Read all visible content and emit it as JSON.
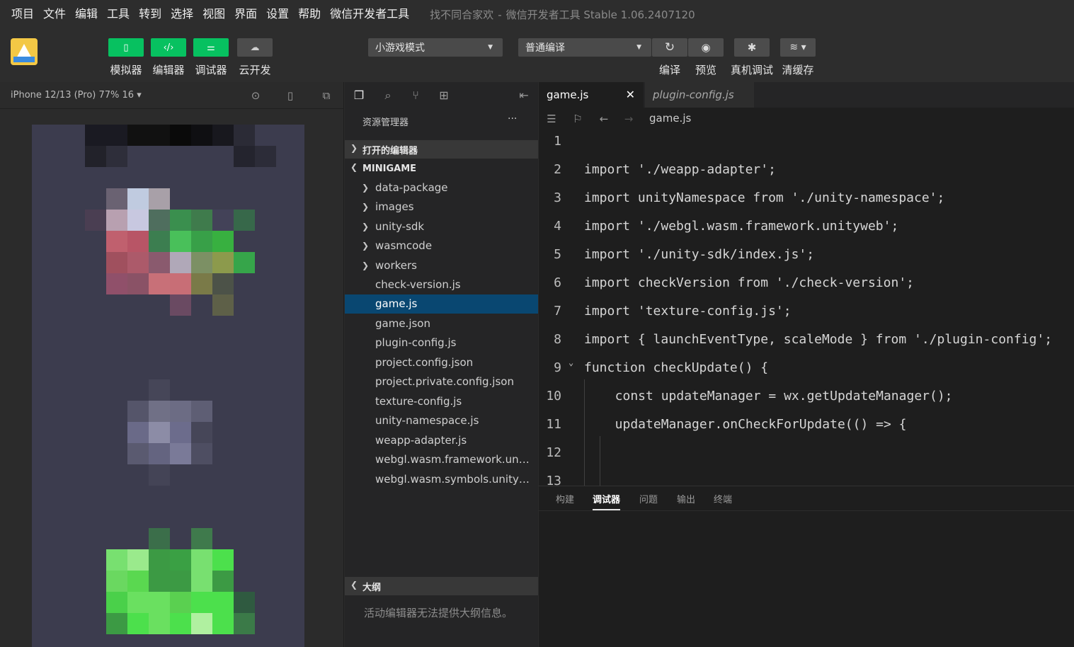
{
  "menubar": {
    "items": [
      "项目",
      "文件",
      "编辑",
      "工具",
      "转到",
      "选择",
      "视图",
      "界面",
      "设置",
      "帮助",
      "微信开发者工具"
    ],
    "project_name": "找不同合家欢",
    "separator": "-",
    "app_title": "微信开发者工具 Stable 1.06.2407120"
  },
  "toolbar": {
    "simulator": "模拟器",
    "editor": "编辑器",
    "debugger": "调试器",
    "cloud": "云开发",
    "mode_select": "小游戏模式",
    "compile_select": "普通编译",
    "compile": "编译",
    "preview": "预览",
    "remote_debug": "真机调试",
    "clear_cache": "清缓存",
    "accent_color": "#07c160"
  },
  "simulator": {
    "device": "iPhone 12/13 (Pro) 77% 16 ▾"
  },
  "explorer": {
    "title": "资源管理器",
    "more": "···",
    "open_editors": "打开的编辑器",
    "project": "MINIGAME",
    "folders": [
      "data-package",
      "images",
      "unity-sdk",
      "wasmcode",
      "workers"
    ],
    "files": [
      "check-version.js",
      "game.js",
      "game.json",
      "plugin-config.js",
      "project.config.json",
      "project.private.config.json",
      "texture-config.js",
      "unity-namespace.js",
      "weapp-adapter.js",
      "webgl.wasm.framework.unityweb",
      "webgl.wasm.symbols.unityweb"
    ],
    "selected_file": "game.js",
    "outline": "大纲",
    "outline_message": "活动编辑器无法提供大纲信息。"
  },
  "editor": {
    "tabs": [
      {
        "label": "game.js",
        "active": true
      },
      {
        "label": "plugin-config.js",
        "active": false
      }
    ],
    "close_glyph": "✕",
    "breadcrumb": "game.js",
    "lines": [
      {
        "n": "1",
        "text": ""
      },
      {
        "n": "2",
        "text": "import './weapp-adapter';"
      },
      {
        "n": "3",
        "text": "import unityNamespace from './unity-namespace';"
      },
      {
        "n": "4",
        "text": "import './webgl.wasm.framework.unityweb';"
      },
      {
        "n": "5",
        "text": "import './unity-sdk/index.js';"
      },
      {
        "n": "6",
        "text": "import checkVersion from './check-version';"
      },
      {
        "n": "7",
        "text": "import 'texture-config.js';"
      },
      {
        "n": "8",
        "text": "import { launchEventType, scaleMode } from './plugin-config';"
      },
      {
        "n": "9",
        "text": "function checkUpdate() {"
      },
      {
        "n": "10",
        "text": "  const updateManager = wx.getUpdateManager();"
      },
      {
        "n": "11",
        "text": "  updateManager.onCheckForUpdate(() => {"
      },
      {
        "n": "12",
        "text": ""
      },
      {
        "n": "13",
        "text": ""
      }
    ]
  },
  "panel": {
    "tabs": [
      "构建",
      "调试器",
      "问题",
      "输出",
      "终端"
    ],
    "active_tab": "调试器"
  }
}
